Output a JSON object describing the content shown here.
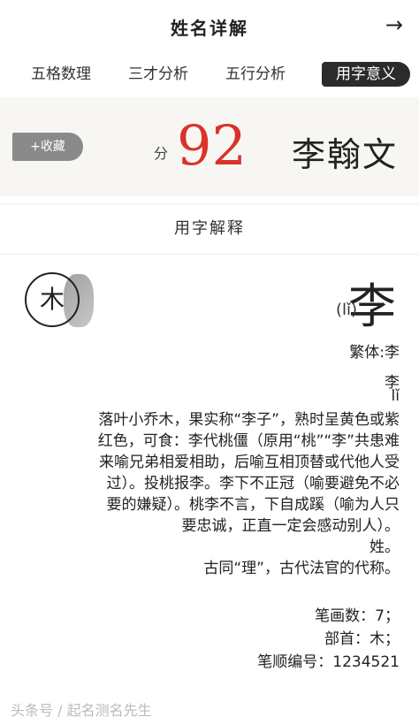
{
  "header": {
    "title": "姓名详解",
    "back_icon": "arrow-right-icon"
  },
  "tabs": [
    {
      "label": "用字意义",
      "active": true
    },
    {
      "label": "五行分析",
      "active": false
    },
    {
      "label": "三才分析",
      "active": false
    },
    {
      "label": "五格数理",
      "active": false
    }
  ],
  "score": {
    "name": "李翰文",
    "value": "92",
    "unit": "分",
    "fav_label": "+收藏"
  },
  "section": {
    "title": "用字解释"
  },
  "character": {
    "char": "李",
    "pinyin": "(lǐ)",
    "element": "木",
    "traditional": "繁体:李",
    "lines": [
      "李",
      "lǐ",
      "落叶小乔木，果实称“李子”，熟时呈黄色或紫",
      "红色，可食：李代桃僵（原用“桃”“李”共患难",
      "来喻兄弟相爱相助，后喻互相顶替或代他人受",
      "过）。投桃报李。李下不正冠（喻要避免不必",
      "要的嫌疑）。桃李不言，下自成蹊（喻为人只",
      "要忠诚，正直一定会感动别人）。",
      "姓。",
      "古同“理”，古代法官的代称。"
    ],
    "strokes": "笔画数：7；",
    "radical": "部首：木；",
    "stroke_order": "笔顺编号：1234521"
  },
  "footer": {
    "text": "头条号 / 起名测名先生"
  }
}
